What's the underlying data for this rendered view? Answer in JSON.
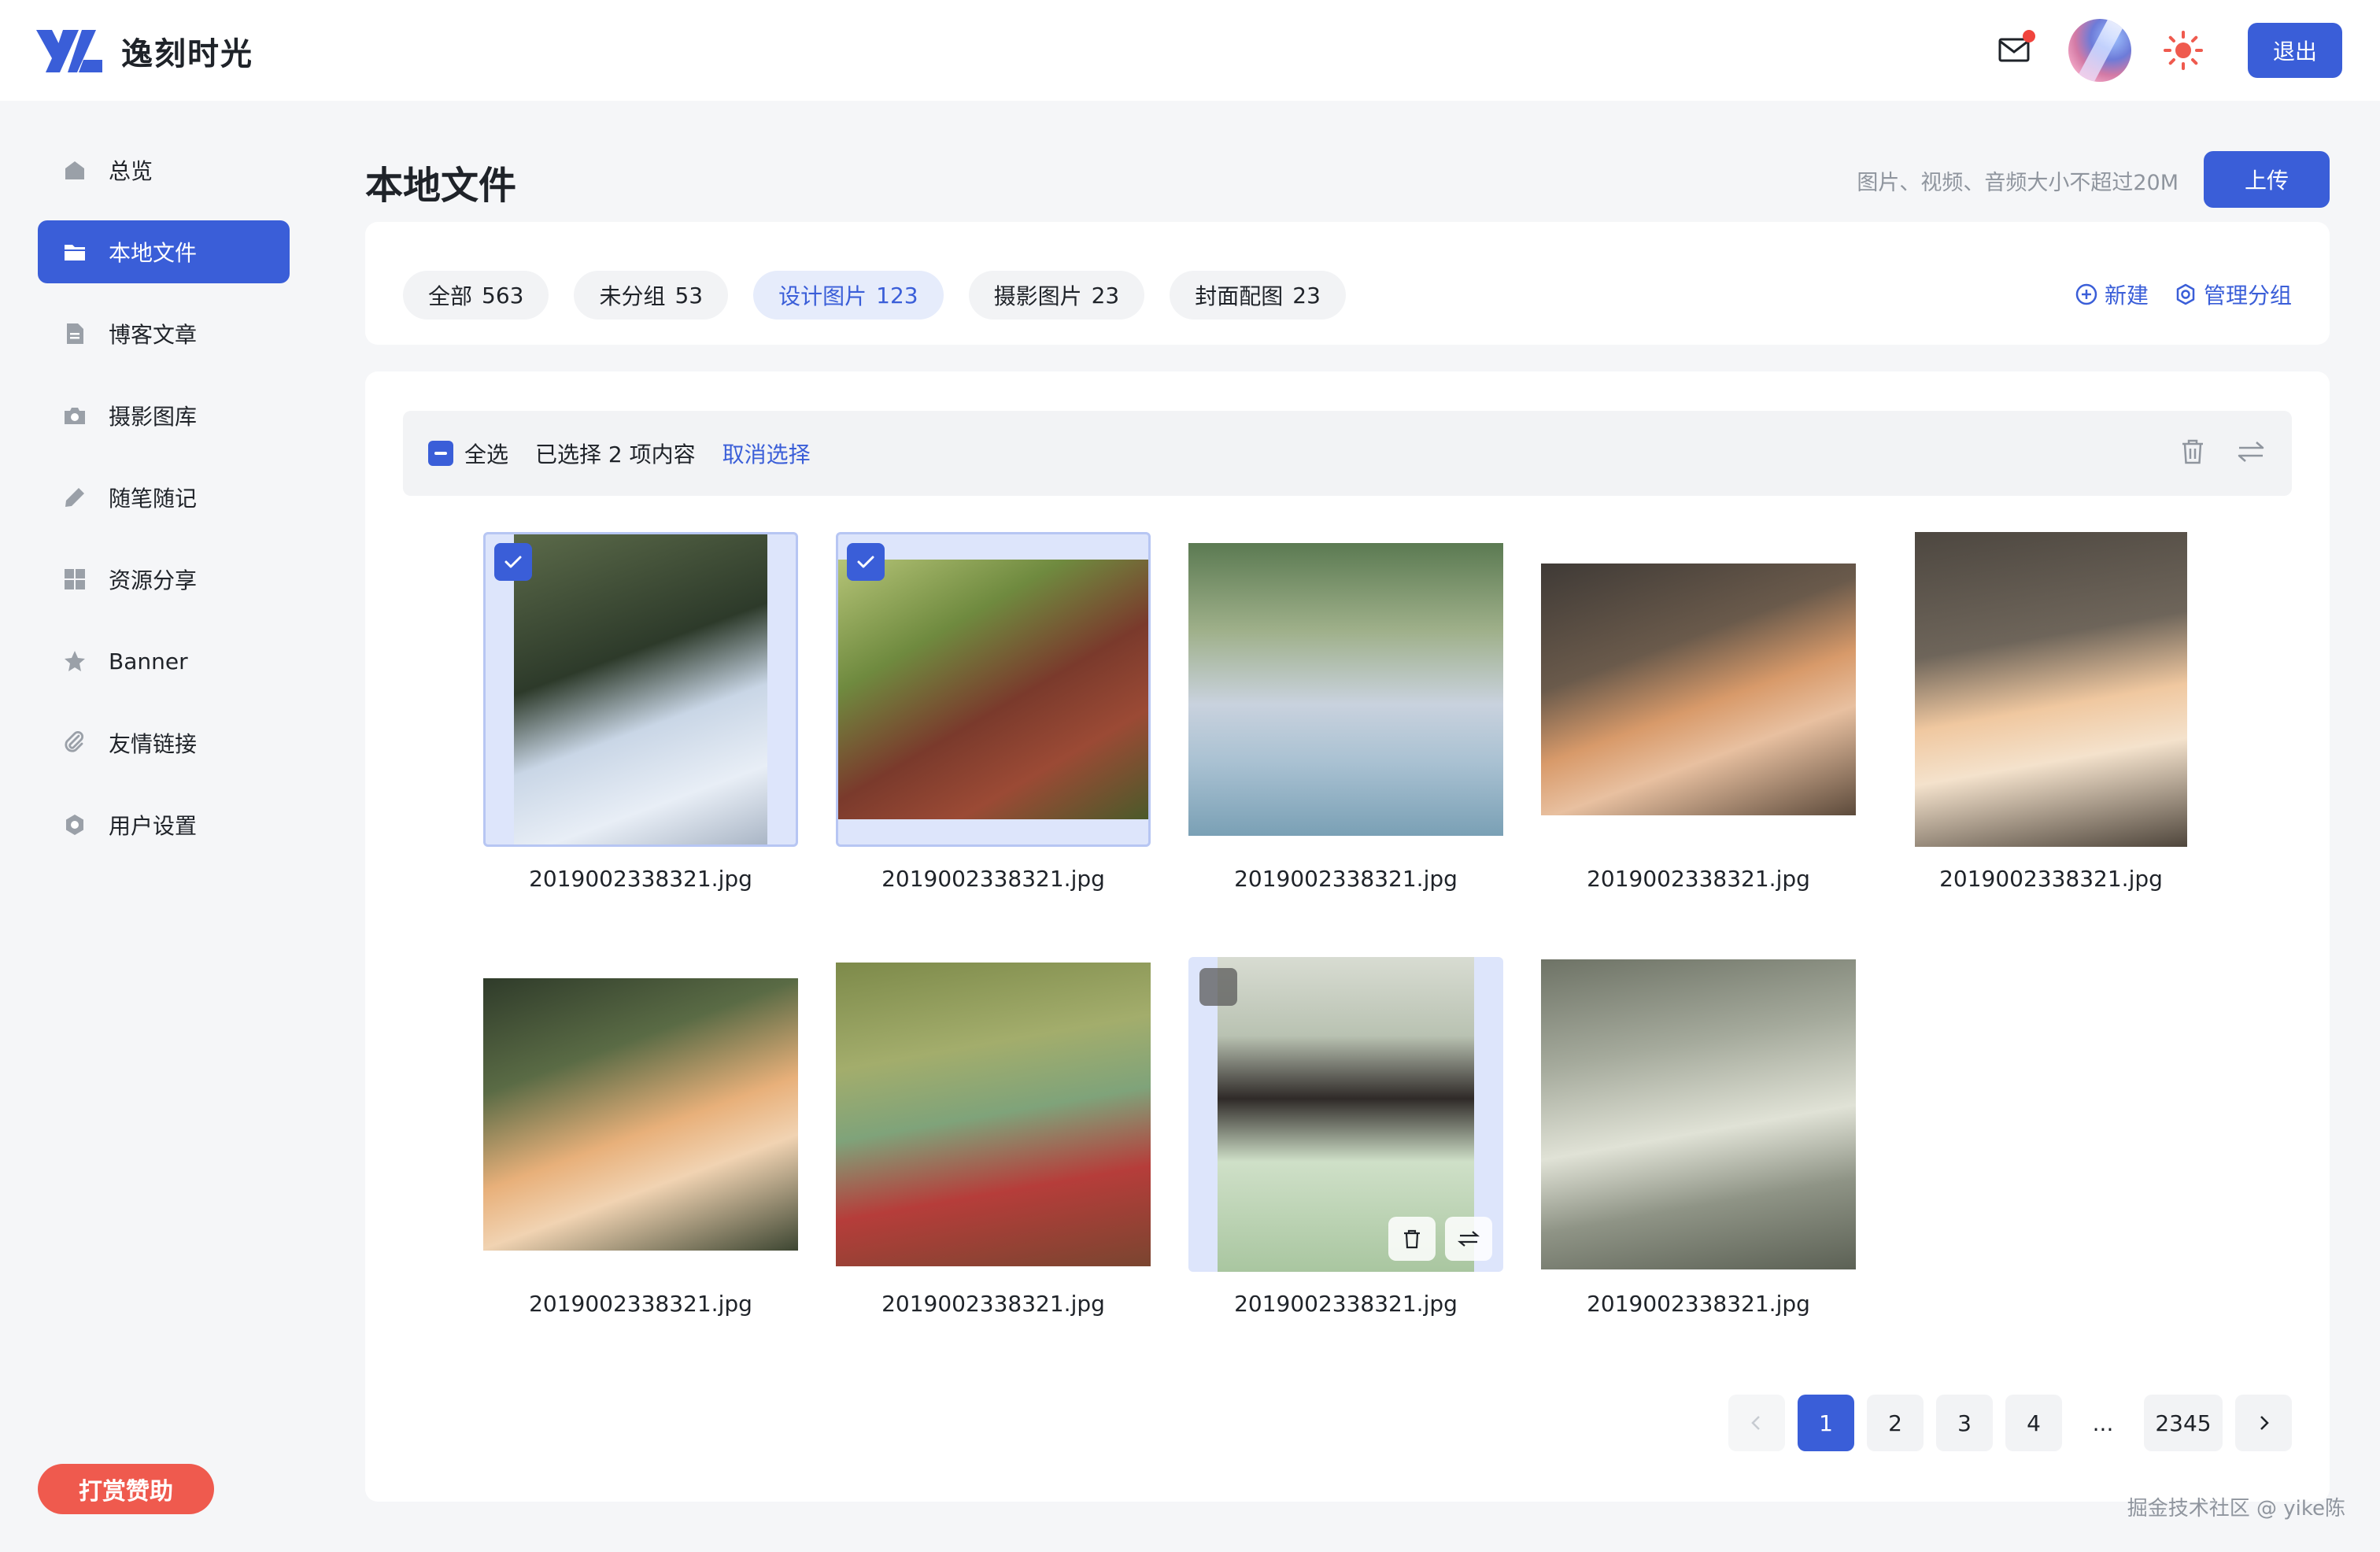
{
  "app": {
    "name": "逸刻时光",
    "logout_label": "退出",
    "brand_color": "#3a5ed8"
  },
  "sidebar": {
    "items": [
      {
        "label": "总览",
        "icon": "home-icon"
      },
      {
        "label": "本地文件",
        "icon": "folder-icon",
        "active": true
      },
      {
        "label": "博客文章",
        "icon": "document-icon"
      },
      {
        "label": "摄影图库",
        "icon": "camera-icon"
      },
      {
        "label": "随笔随记",
        "icon": "pencil-icon"
      },
      {
        "label": "资源分享",
        "icon": "grid-icon"
      },
      {
        "label": "Banner",
        "icon": "star-icon"
      },
      {
        "label": "友情链接",
        "icon": "paperclip-icon"
      },
      {
        "label": "用户设置",
        "icon": "settings-icon"
      }
    ],
    "sponsor_label": "打赏赞助"
  },
  "main": {
    "title": "本地文件",
    "upload_hint": "图片、视频、音频大小不超过20M",
    "upload_label": "上传",
    "groups": [
      {
        "name": "全部",
        "count": "563"
      },
      {
        "name": "未分组",
        "count": "53"
      },
      {
        "name": "设计图片",
        "count": "123",
        "active": true
      },
      {
        "name": "摄影图片",
        "count": "23"
      },
      {
        "name": "封面配图",
        "count": "23"
      }
    ],
    "new_label": "新建",
    "manage_label": "管理分组",
    "selection": {
      "select_all": "全选",
      "selected_text": "已选择 2 项内容",
      "cancel_label": "取消选择"
    },
    "files": [
      {
        "name": "2019002338321.jpg",
        "selected": true
      },
      {
        "name": "2019002338321.jpg",
        "selected": true
      },
      {
        "name": "2019002338321.jpg"
      },
      {
        "name": "2019002338321.jpg"
      },
      {
        "name": "2019002338321.jpg"
      },
      {
        "name": "2019002338321.jpg"
      },
      {
        "name": "2019002338321.jpg"
      },
      {
        "name": "2019002338321.jpg",
        "hovered": true
      },
      {
        "name": "2019002338321.jpg"
      }
    ],
    "pagination": {
      "pages": [
        "1",
        "2",
        "3",
        "4"
      ],
      "ellipsis": "...",
      "last": "2345",
      "current": "1"
    }
  },
  "watermark": "掘金技术社区 @ yike陈"
}
